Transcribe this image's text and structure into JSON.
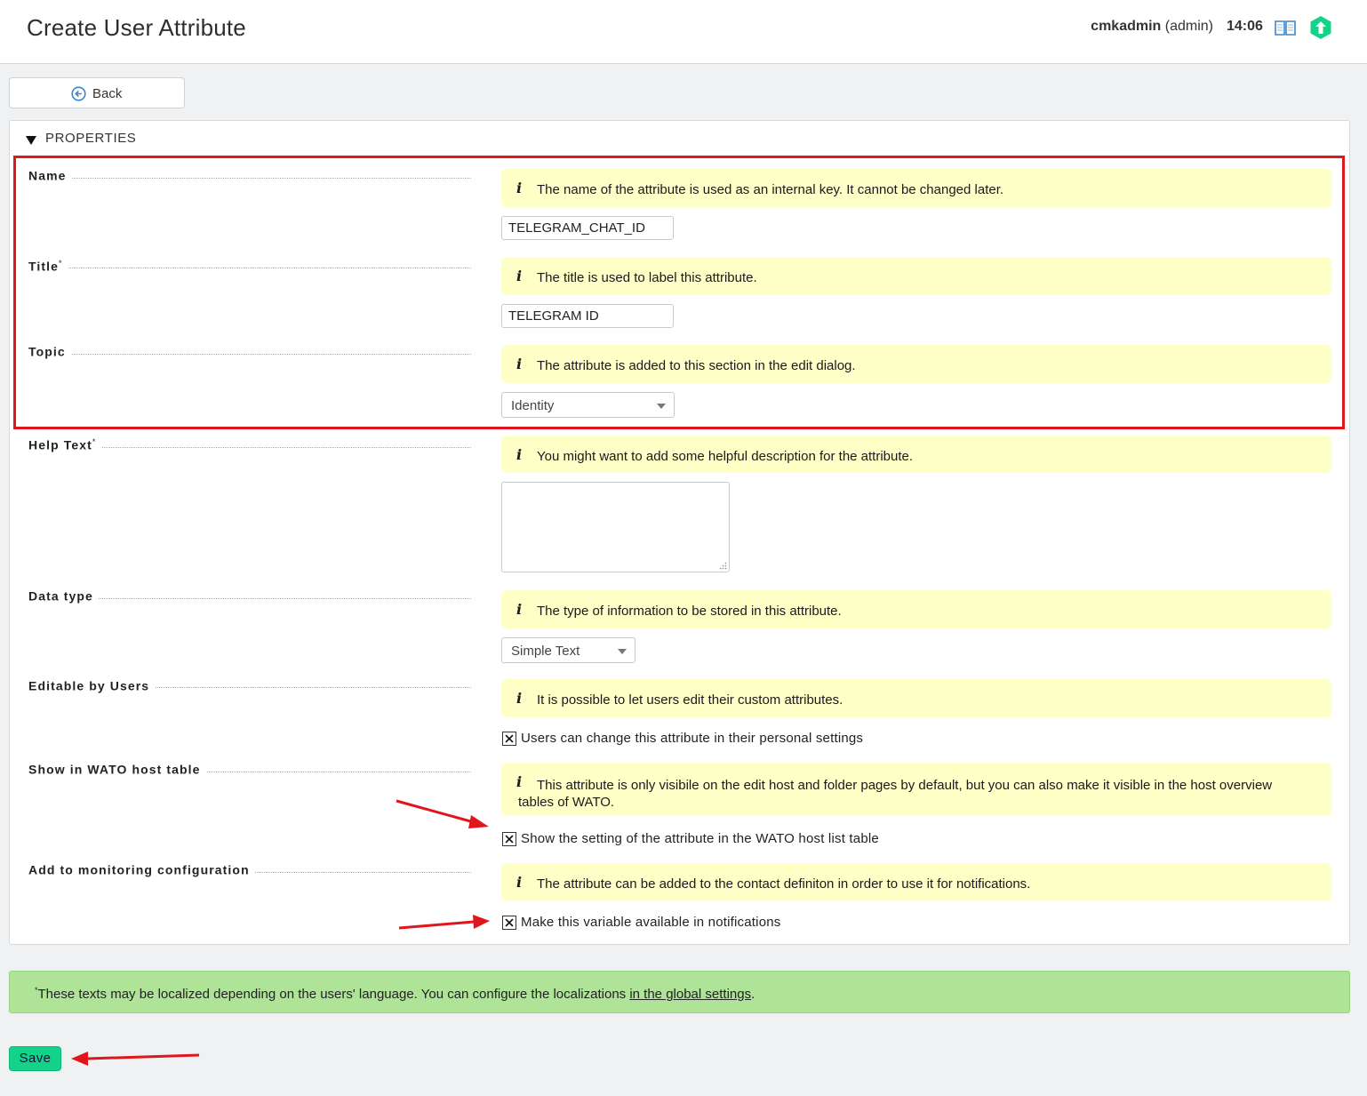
{
  "header": {
    "title": "Create User Attribute",
    "username": "cmkadmin",
    "role": "(admin)",
    "time": "14:06",
    "icons": [
      "book-icon",
      "checkmk-logo-icon"
    ]
  },
  "toolbar": {
    "back_label": "Back",
    "back_icon": "back-arrow-icon"
  },
  "properties": {
    "title": "PROPERTIES",
    "fields": [
      {
        "label": "Name",
        "required_mark": "",
        "help": "The name of the attribute is used as an internal key. It cannot be changed later.",
        "value": "TELEGRAM_CHAT_ID"
      },
      {
        "label": "Title",
        "required_mark": "*",
        "help": "The title is used to label this attribute.",
        "value": "TELEGRAM ID"
      },
      {
        "label": "Topic",
        "required_mark": "",
        "help": "The attribute is added to this section in the edit dialog.",
        "value": "Identity"
      },
      {
        "label": "Help Text",
        "required_mark": "*",
        "help": "You might want to add some helpful description for the attribute.",
        "value": ""
      },
      {
        "label": "Data type",
        "required_mark": "",
        "help": "The type of information to be stored in this attribute.",
        "value": "Simple Text"
      },
      {
        "label": "Editable by Users",
        "required_mark": "",
        "help": "It is possible to let users edit their custom attributes.",
        "checkbox_label": "Users can change this attribute in their personal settings",
        "checked": true
      },
      {
        "label": "Show in WATO host table",
        "required_mark": "",
        "help": "This attribute is only visibile on the edit host and folder pages by default, but you can also make it visible in the host overview tables of WATO.",
        "checkbox_label": "Show the setting of the attribute in the WATO host list table",
        "checked": true
      },
      {
        "label": "Add to monitoring configuration",
        "required_mark": "",
        "help": "The attribute can be added to the contact definiton in order to use it for notifications.",
        "checkbox_label": "Make this variable available in notifications",
        "checked": true
      }
    ]
  },
  "footnote": {
    "mark": "*",
    "text": "These texts may be localized depending on the users' language. You can configure the localizations ",
    "link": "in the global settings",
    "end": "."
  },
  "save_label": "Save",
  "colors": {
    "help_background": "#ffffc8",
    "footnote_background": "#aee398",
    "save_button": "#13d389",
    "annotation_red": "#e0161d",
    "brand_green": "#13d389"
  }
}
